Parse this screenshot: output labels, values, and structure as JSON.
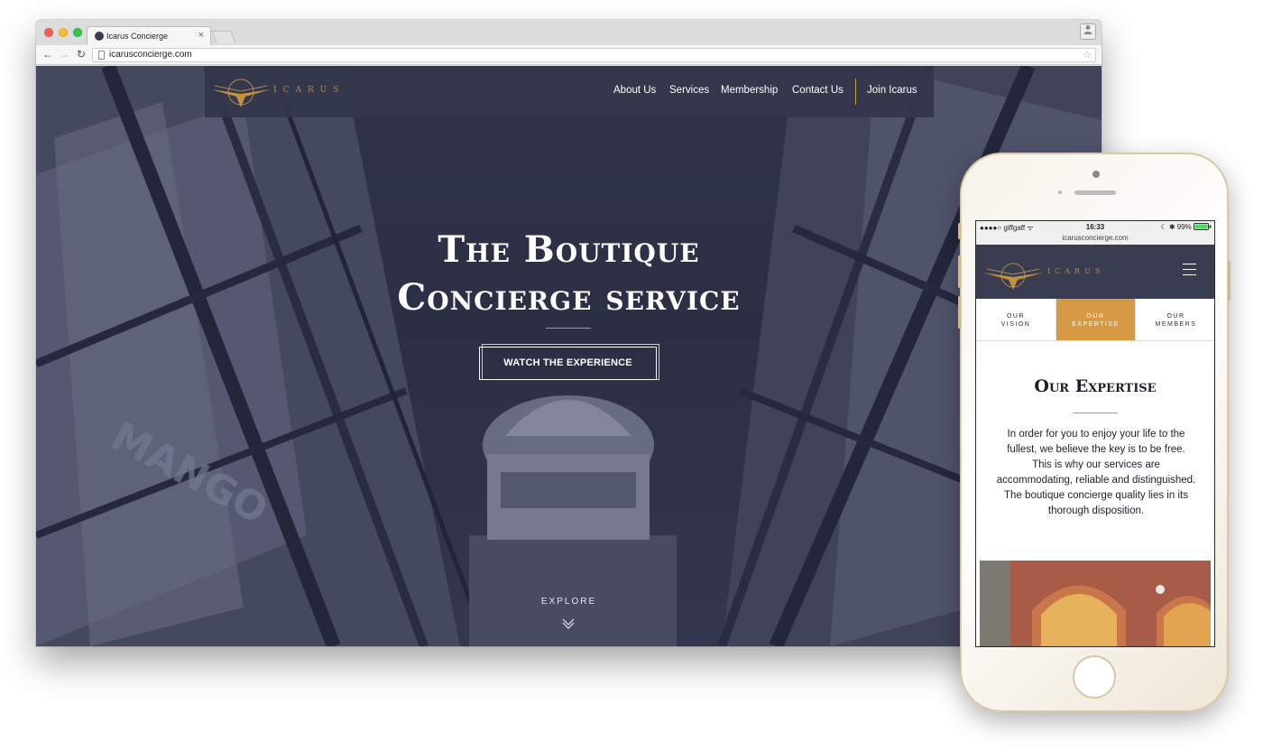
{
  "browser": {
    "tab_title": "Icarus Concierge",
    "tab_close": "×",
    "url": "icarusconcierge.com",
    "back_icon": "←",
    "forward_icon": "→",
    "reload_icon": "↻",
    "star_icon": "☆"
  },
  "site": {
    "logo_text": "ICARUS",
    "nav": {
      "about": "About Us",
      "services": "Services",
      "membership": "Membership",
      "contact": "Contact Us",
      "join": "Join Icarus"
    },
    "hero": {
      "title_line1": "The Boutique",
      "title_line2": "Concierge service",
      "cta": "WATCH THE EXPERIENCE",
      "explore": "EXPLORE"
    }
  },
  "phone": {
    "status": {
      "carrier": "●●●●○ giffgaff ᯤ",
      "time": "16:33",
      "battery": "☾ ✱ 99%"
    },
    "url": "icarusconcierge.com",
    "logo_text": "ICARUS",
    "tabs": [
      {
        "line1": "OUR",
        "line2": "VISION"
      },
      {
        "line1": "OUR",
        "line2": "EXPERTISE"
      },
      {
        "line1": "OUR",
        "line2": "MEMBERS"
      }
    ],
    "heading": "Our Expertise",
    "paragraph": "In order for you to enjoy your life to the fullest, we believe the key is to be free. This is why our services are accommodating, reliable and distinguished. The boutique concierge quality lies in its thorough disposition."
  },
  "colors": {
    "navy": "#3a3d52",
    "gold": "#c99a45",
    "active_tab": "#d59a43"
  }
}
